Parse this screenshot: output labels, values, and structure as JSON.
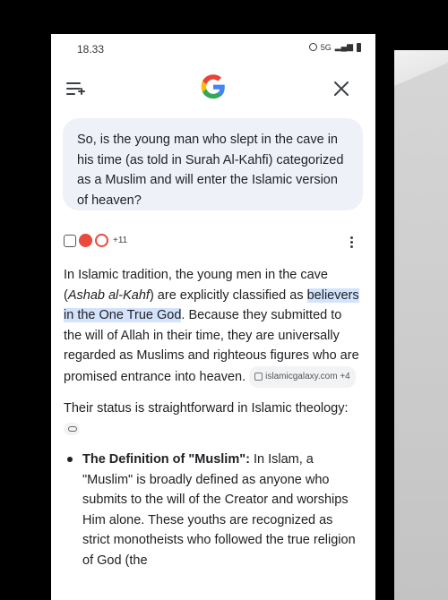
{
  "status": {
    "time": "18.33",
    "network": "5G"
  },
  "query": {
    "text": "So, is the young man who slept in the cave in his time (as told in Surah Al-Kahfi) categorized as a Muslim and will enter the Islamic version of heaven?"
  },
  "sources": {
    "more_count": "+11"
  },
  "answer": {
    "p1_before": "In Islamic tradition, the young men in the cave (",
    "p1_italic": "Ashab al-Kahf",
    "p1_mid": ") are explicitly classified as ",
    "p1_highlight": "believers in the One True God",
    "p1_after": ". Because they submitted to the will of Allah in their time, they are universally regarded as Muslims and righteous figures who are promised entrance into heaven.",
    "p1_citation": "islamicgalaxy.com +4",
    "p2": "Their status is straightforward in Islamic theology:",
    "bullet1_title": "The Definition of \"Muslim\":",
    "bullet1_text": " In Islam, a \"Muslim\" is broadly defined as anyone who submits to the will of the Creator and worships Him alone. These youths are recognized as strict monotheists who followed the true religion of God (the"
  },
  "colors": {
    "highlight": "#d3e3fd",
    "query_bg": "#eef1f8"
  },
  "icons": [
    "menu-icon",
    "google-logo",
    "close-icon",
    "more-vert-icon",
    "link-icon"
  ]
}
